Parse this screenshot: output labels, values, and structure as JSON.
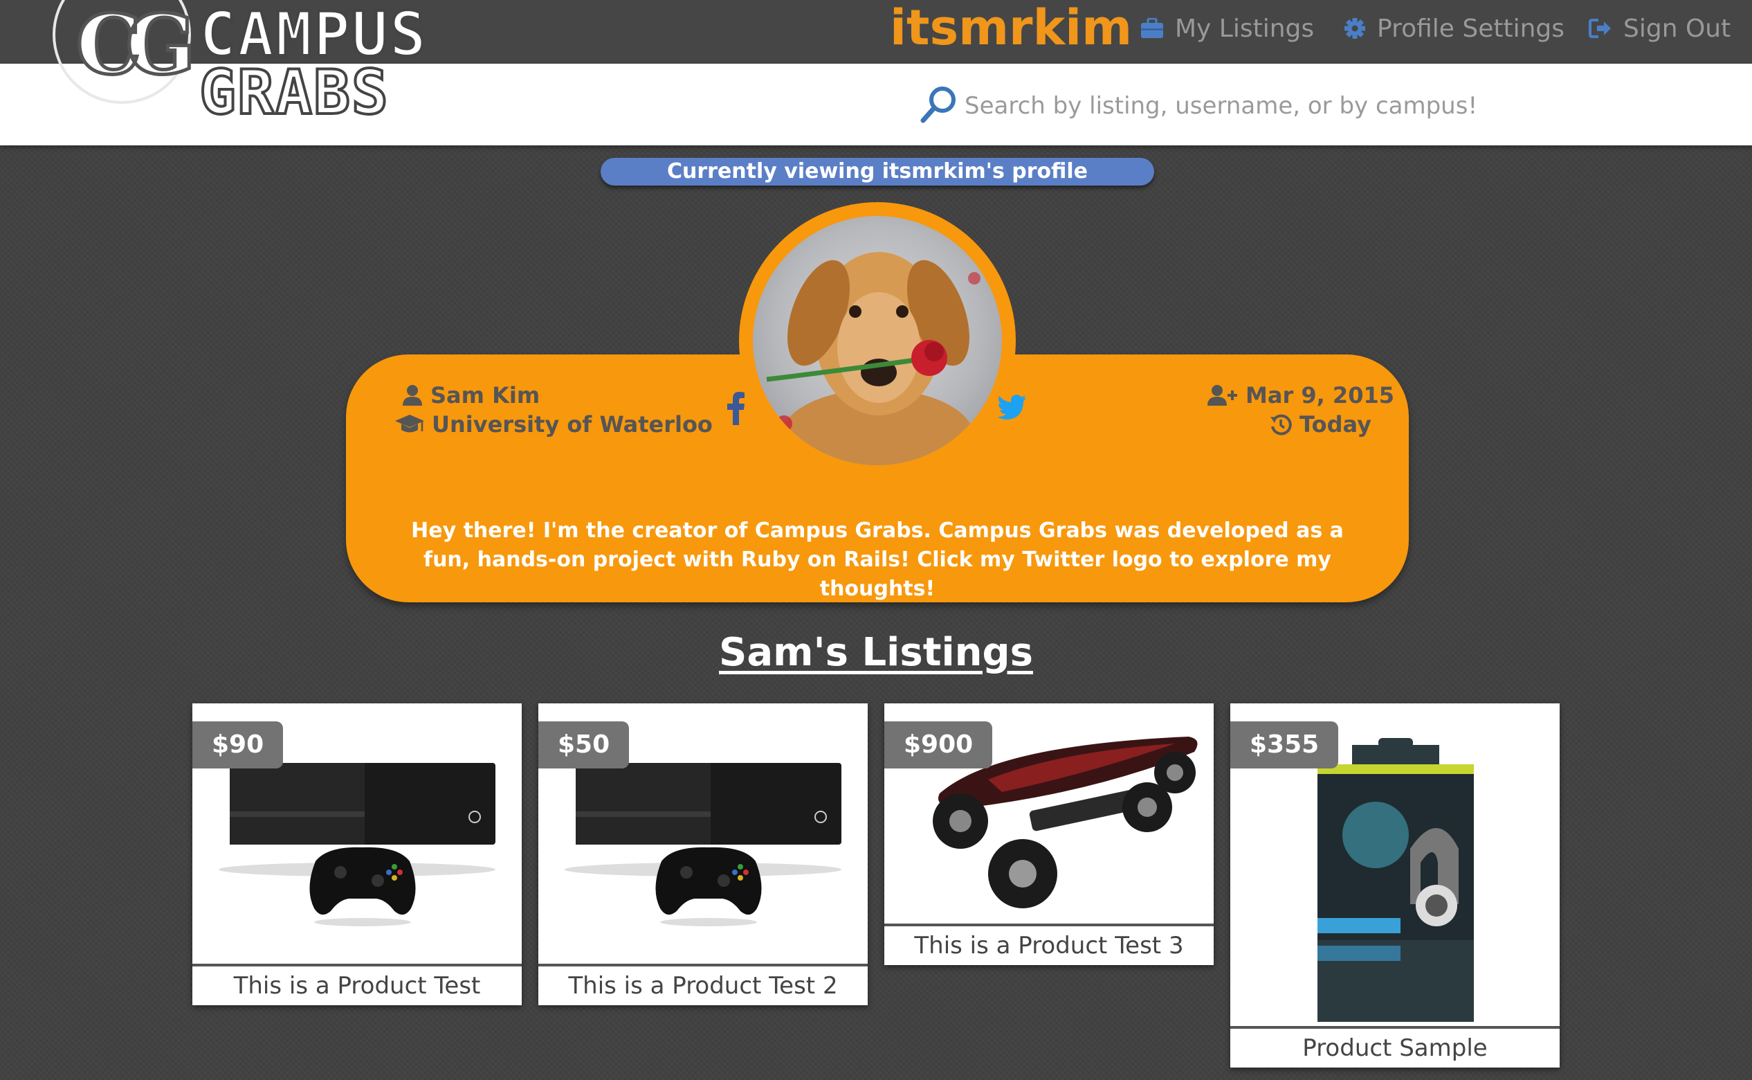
{
  "brand": {
    "logo_mono": "CG",
    "logo_line1": "CAMPUS",
    "logo_line2": "GRABS"
  },
  "nav": {
    "username": "itsmrkim",
    "my_listings": "My Listings",
    "profile_settings": "Profile Settings",
    "sign_out": "Sign Out"
  },
  "search": {
    "placeholder": "Search by listing, username, or by campus!"
  },
  "banner": "Currently viewing itsmrkim's profile",
  "profile": {
    "name": "Sam Kim",
    "school": "University of Waterloo",
    "joined": "Mar 9, 2015",
    "last_active": "Today",
    "bio": "Hey there! I'm the creator of Campus Grabs. Campus Grabs was developed as a fun, hands-on project with Ruby on Rails! Click my Twitter logo to explore my thoughts!"
  },
  "listings": {
    "title": "Sam's Listings",
    "items": [
      {
        "price": "$90",
        "title": "This is a Product Test"
      },
      {
        "price": "$50",
        "title": "This is a Product Test 2"
      },
      {
        "price": "$900",
        "title": "This is a Product Test 3"
      },
      {
        "price": "$355",
        "title": "Product Sample"
      }
    ]
  },
  "colors": {
    "accent": "#f8980d",
    "banner": "#5b7fc6",
    "nav_icon": "#4a7fc8",
    "social_fb": "#3b5998",
    "social_tw": "#1da1f2"
  },
  "icons": [
    "briefcase-icon",
    "gear-icon",
    "sign-out-icon",
    "search-icon",
    "user-icon",
    "graduation-cap-icon",
    "user-plus-icon",
    "history-icon",
    "facebook-icon",
    "twitter-icon"
  ]
}
